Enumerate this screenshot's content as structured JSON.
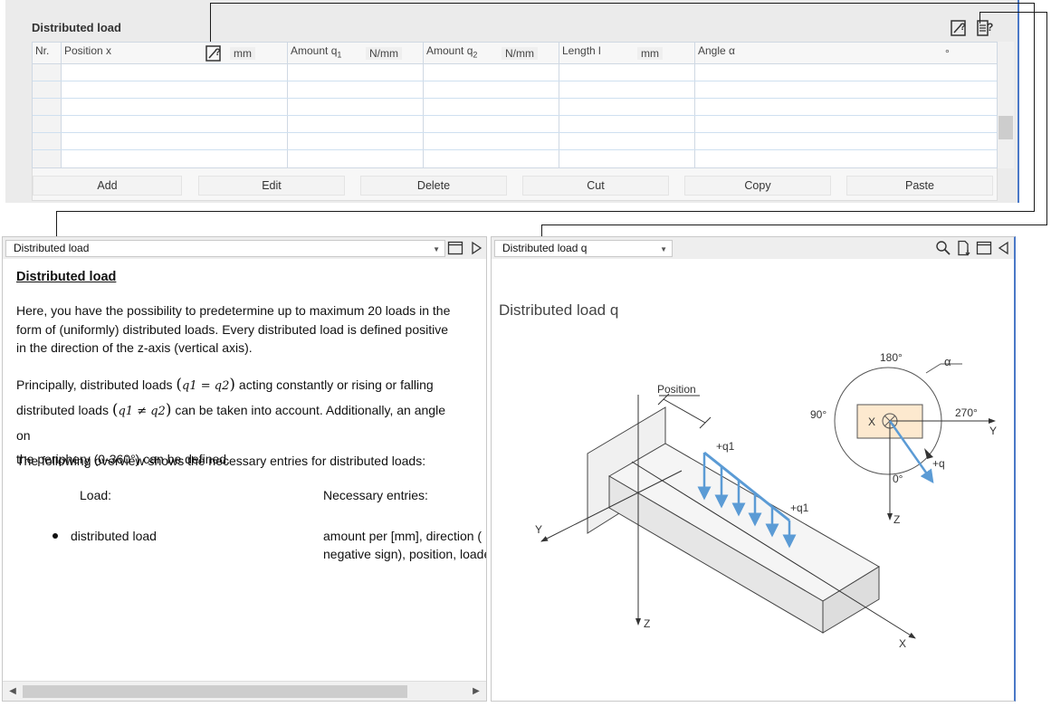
{
  "top_panel": {
    "title": "Distributed load",
    "columns": [
      {
        "label": "Nr.",
        "unit": ""
      },
      {
        "label": "Position x",
        "unit": "mm"
      },
      {
        "label": "Amount q",
        "sub": "1",
        "unit": "N/mm"
      },
      {
        "label": "Amount q",
        "sub": "2",
        "unit": "N/mm"
      },
      {
        "label": "Length l",
        "unit": "mm"
      },
      {
        "label": "Angle α",
        "unit": "°"
      }
    ],
    "buttons": [
      "Add",
      "Edit",
      "Delete",
      "Cut",
      "Copy",
      "Paste"
    ]
  },
  "left_panel": {
    "select_value": "Distributed load",
    "heading": "Distributed load",
    "para1": "Here, you have the possibility to predetermine up to maximum 20 loads in the form of (uniformly) distributed loads. Every distributed load is defined positive in the direction of the z-axis (vertical axis).",
    "para2_a": "Principally, distributed loads",
    "eq_equal": "q1 = q2",
    "para2_b": "acting constantly or rising or falling",
    "para2_c": "distributed loads",
    "eq_notequal": "q1 ≠ q2",
    "para2_d": "can be taken into account. Additionally, an angle on",
    "para2_e": "the periphery (0-360°) can be defined.",
    "para3": "The following overview shows the necessary entries for distributed loads:",
    "col_load": "Load:",
    "col_entries": "Necessary entries:",
    "row_load": "distributed load",
    "row_entries_1": "amount per [mm], direction (",
    "row_entries_2": "negative sign), position, loade"
  },
  "right_panel": {
    "select_value": "Distributed load q",
    "graphic_title": "Distributed load q",
    "labels": {
      "position": "Position",
      "q1_top": "+q1",
      "q1_right": "+q1",
      "axis_y_left": "Y",
      "axis_z_bottom": "Z",
      "axis_x": "X",
      "deg_180": "180°",
      "deg_90": "90°",
      "deg_270": "270°",
      "deg_0": "0°",
      "alpha": "α",
      "circle_x": "X",
      "plus_q": "+q",
      "circle_y": "Y",
      "circle_z": "Z"
    }
  },
  "colors": {
    "accent": "#4a78c7",
    "load_arrow": "#5b9bd5",
    "cross_section_fill": "#fde9cf"
  }
}
